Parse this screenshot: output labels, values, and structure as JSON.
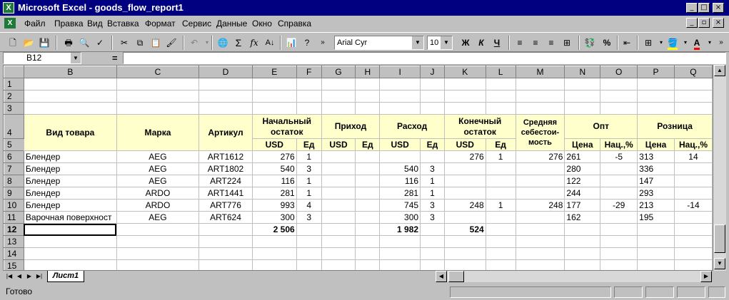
{
  "window": {
    "title": "Microsoft Excel - goods_flow_report1",
    "minimize_glyph": "_",
    "maximize_glyph": "□",
    "close_glyph": "×",
    "restore_glyph": "▫"
  },
  "menu": {
    "items": [
      {
        "label": "Файл"
      },
      {
        "label": "Правка"
      },
      {
        "label": "Вид"
      },
      {
        "label": "Вставка"
      },
      {
        "label": "Формат"
      },
      {
        "label": "Сервис"
      },
      {
        "label": "Данные"
      },
      {
        "label": "Окно"
      },
      {
        "label": "Справка"
      }
    ]
  },
  "toolbar": {
    "font_name": "Arial Cyr",
    "font_size": "10",
    "bold_label": "Ж",
    "italic_label": "К",
    "underline_label": "Ч",
    "percent_label": "%",
    "sum_label": "Σ",
    "fx_label": "fx",
    "sort_label": "А↓"
  },
  "formula_bar": {
    "cell_ref": "B12",
    "equals_label": "=",
    "value": ""
  },
  "grid": {
    "columns": [
      "B",
      "C",
      "D",
      "E",
      "F",
      "G",
      "H",
      "I",
      "J",
      "K",
      "L",
      "M",
      "N",
      "O",
      "P",
      "Q"
    ],
    "row_numbers": [
      "1",
      "2",
      "3",
      "4",
      "5",
      "6",
      "7",
      "8",
      "9",
      "10",
      "11",
      "12",
      "13",
      "14",
      "15"
    ],
    "headers": {
      "vid": "Вид товара",
      "marka": "Марка",
      "artikul": "Артикул",
      "nach": "Начальный остаток",
      "prihod": "Приход",
      "rashod": "Расход",
      "konech": "Конечный остаток",
      "sredn": "Средняя себестои- мость",
      "opt": "Опт",
      "rozn": "Розница",
      "usd": "USD",
      "ed": "Ед",
      "cena": "Цена",
      "nac": "Нац.,%"
    },
    "rows": [
      {
        "row": "6",
        "vid": "Блендер",
        "marka": "AEG",
        "art": "ART1612",
        "nusd": "276",
        "ned": "1",
        "pusd": "",
        "ped": "",
        "rusd": "",
        "red": "",
        "kusd": "276",
        "ked": "1",
        "sr": "276",
        "ocena": "261",
        "onac": "-5",
        "rcena": "313",
        "rnac": "14"
      },
      {
        "row": "7",
        "vid": "Блендер",
        "marka": "AEG",
        "art": "ART1802",
        "nusd": "540",
        "ned": "3",
        "pusd": "",
        "ped": "",
        "rusd": "540",
        "red": "3",
        "kusd": "",
        "ked": "",
        "sr": "",
        "ocena": "280",
        "onac": "",
        "rcena": "336",
        "rnac": ""
      },
      {
        "row": "8",
        "vid": "Блендер",
        "marka": "AEG",
        "art": "ART224",
        "nusd": "116",
        "ned": "1",
        "pusd": "",
        "ped": "",
        "rusd": "116",
        "red": "1",
        "kusd": "",
        "ked": "",
        "sr": "",
        "ocena": "122",
        "onac": "",
        "rcena": "147",
        "rnac": ""
      },
      {
        "row": "9",
        "vid": "Блендер",
        "marka": "ARDO",
        "art": "ART1441",
        "nusd": "281",
        "ned": "1",
        "pusd": "",
        "ped": "",
        "rusd": "281",
        "red": "1",
        "kusd": "",
        "ked": "",
        "sr": "",
        "ocena": "244",
        "onac": "",
        "rcena": "293",
        "rnac": ""
      },
      {
        "row": "10",
        "vid": "Блендер",
        "marka": "ARDO",
        "art": "ART776",
        "nusd": "993",
        "ned": "4",
        "pusd": "",
        "ped": "",
        "rusd": "745",
        "red": "3",
        "kusd": "248",
        "ked": "1",
        "sr": "248",
        "ocena": "177",
        "onac": "-29",
        "rcena": "213",
        "rnac": "-14"
      },
      {
        "row": "11",
        "vid": "Варочная поверхност",
        "marka": "AEG",
        "art": "ART624",
        "nusd": "300",
        "ned": "3",
        "pusd": "",
        "ped": "",
        "rusd": "300",
        "red": "3",
        "kusd": "",
        "ked": "",
        "sr": "",
        "ocena": "162",
        "onac": "",
        "rcena": "195",
        "rnac": ""
      }
    ],
    "totals": {
      "nusd": "2 506",
      "rusd": "1 982",
      "kusd": "524"
    }
  },
  "sheet_tabs": {
    "active": "Лист1"
  },
  "status": {
    "text": "Готово"
  },
  "colors": {
    "title_bar": "#000080",
    "header_fill": "#ffffcc",
    "chrome": "#c0c0c0"
  }
}
